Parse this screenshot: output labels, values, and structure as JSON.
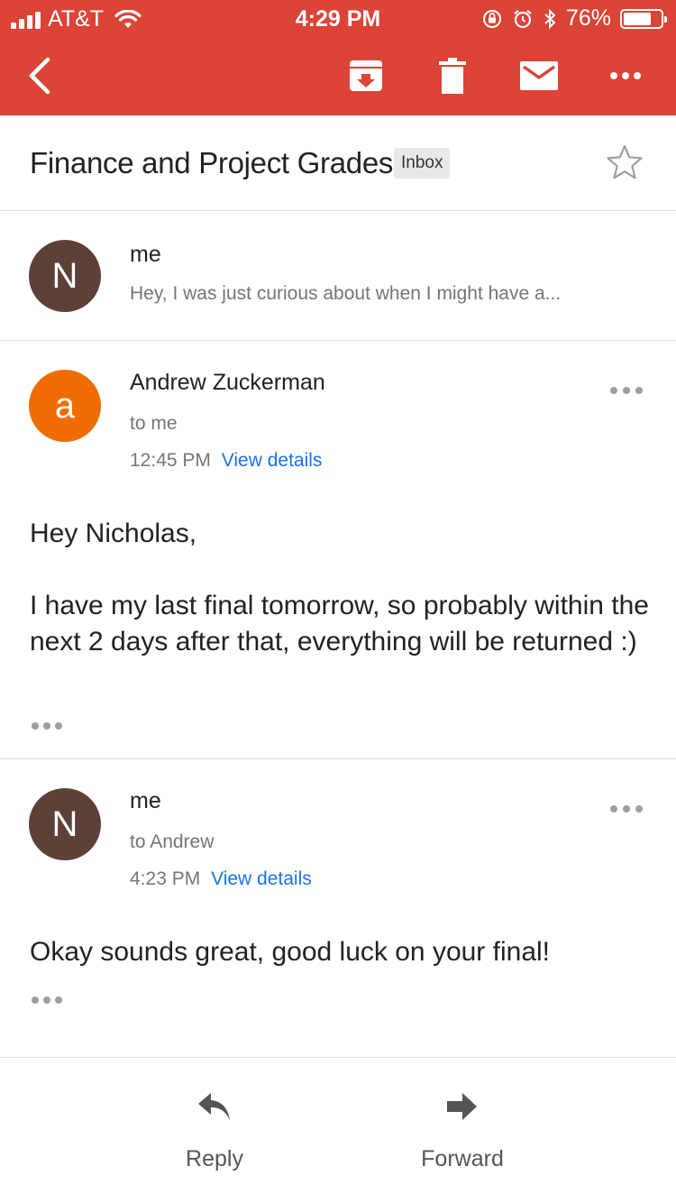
{
  "status_bar": {
    "carrier": "AT&T",
    "time": "4:29 PM",
    "battery": "76%",
    "battery_level": 0.76,
    "icons": [
      "signal-icon",
      "wifi-icon",
      "rotation-lock-icon",
      "alarm-icon",
      "bluetooth-icon",
      "battery-icon"
    ]
  },
  "toolbar": {
    "accent_color": "#db4437",
    "icons": [
      "back-icon",
      "archive-icon",
      "trash-icon",
      "mail-icon",
      "more-icon"
    ]
  },
  "thread": {
    "subject": "Finance and Project Grades",
    "label": "Inbox",
    "star_icon": "star-icon"
  },
  "messages": [
    {
      "avatar_letter": "N",
      "avatar_color": "#5d4037",
      "sender": "me",
      "snippet": "Hey, I was just curious about when I might have a..."
    },
    {
      "avatar_letter": "a",
      "avatar_color": "#ef6c00",
      "sender": "Andrew Zuckerman",
      "recipient": "to me",
      "time": "12:45 PM",
      "details_link": "View details",
      "body": "Hey Nicholas,\n\nI have my last final tomorrow, so probably within the next 2 days after that, everything will be returned :)"
    },
    {
      "avatar_letter": "N",
      "avatar_color": "#5d4037",
      "sender": "me",
      "recipient": "to Andrew",
      "time": "4:23 PM",
      "details_link": "View details",
      "body": "Okay sounds great, good luck on your final!"
    }
  ],
  "actions": {
    "reply": "Reply",
    "forward": "Forward"
  }
}
